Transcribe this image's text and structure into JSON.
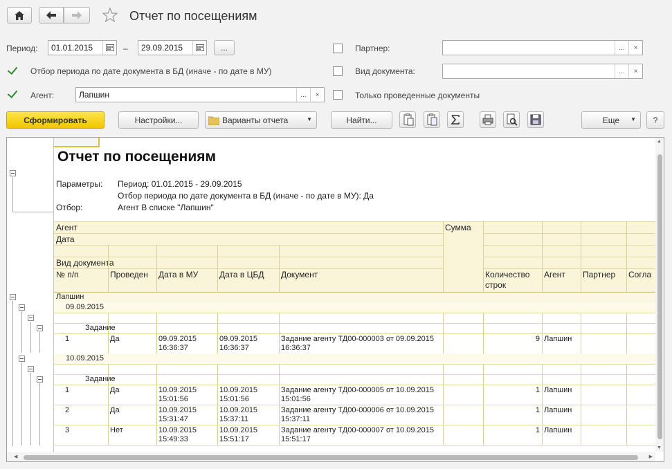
{
  "window": {
    "title": "Отчет по посещениям"
  },
  "filters": {
    "period_label": "Период:",
    "date_from": "01.01.2015",
    "date_dash": "–",
    "date_to": "29.09.2015",
    "more_btn": "...",
    "filter_by_db_date": "Отбор периода по дате документа в БД (иначе - по дате в МУ)",
    "agent_label": "Агент:",
    "agent_value": "Лапшин",
    "partner_label": "Партнер:",
    "doc_type_label": "Вид документа:",
    "only_posted_label": "Только проведенные документы",
    "dots": "...",
    "clear": "×"
  },
  "toolbar": {
    "generate": "Сформировать",
    "settings": "Настройки...",
    "variants": "Варианты отчета",
    "find": "Найти...",
    "more": "Еще",
    "help": "?"
  },
  "report": {
    "title": "Отчет по посещениям",
    "params_label": "Параметры:",
    "param_period": "Период: 01.01.2015 - 29.09.2015",
    "param_filter": "Отбор периода по дате документа в БД (иначе - по дате в МУ): Да",
    "filter_label": "Отбор:",
    "filter_value": "Агент В списке \"Лапшин\"",
    "headers": {
      "agent": "Агент",
      "date": "Дата",
      "doc_type": "Вид документа",
      "num": "№ п/п",
      "posted": "Проведен",
      "date_mu": "Дата в МУ",
      "date_cbd": "Дата в ЦБД",
      "document": "Документ",
      "sum": "Сумма",
      "lines_count": "Количество строк",
      "agent_col": "Агент",
      "partner": "Партнер",
      "agreement": "Согла"
    },
    "group_agent": "Лапшин",
    "group_date1": "09.09.2015",
    "group_date2": "10.09.2015",
    "doc_type_value": "Задание",
    "rows": [
      {
        "num": "1",
        "posted": "Да",
        "mu1": "09.09.2015",
        "mu2": "16:36:37",
        "cbd1": "09.09.2015",
        "cbd2": "16:36:37",
        "doc1": "Задание агенту ТД00-000003 от 09.09.2015",
        "doc2": "16:36:37",
        "count": "9",
        "agent": "Лапшин"
      },
      {
        "num": "1",
        "posted": "Да",
        "mu1": "10.09.2015",
        "mu2": "15:01:56",
        "cbd1": "10.09.2015",
        "cbd2": "15:01:56",
        "doc1": "Задание агенту ТД00-000005 от 10.09.2015",
        "doc2": "15:01:56",
        "count": "1",
        "agent": "Лапшин"
      },
      {
        "num": "2",
        "posted": "Да",
        "mu1": "10.09.2015",
        "mu2": "15:31:47",
        "cbd1": "10.09.2015",
        "cbd2": "15:37:11",
        "doc1": "Задание агенту ТД00-000006 от 10.09.2015",
        "doc2": "15:37:11",
        "count": "1",
        "agent": "Лапшин"
      },
      {
        "num": "3",
        "posted": "Нет",
        "mu1": "10.09.2015",
        "mu2": "15:49:33",
        "cbd1": "10.09.2015",
        "cbd2": "15:51:17",
        "doc1": "Задание агенту ТД00-000007 от 10.09.2015",
        "doc2": "15:51:17",
        "count": "1",
        "agent": "Лапшин"
      }
    ]
  }
}
